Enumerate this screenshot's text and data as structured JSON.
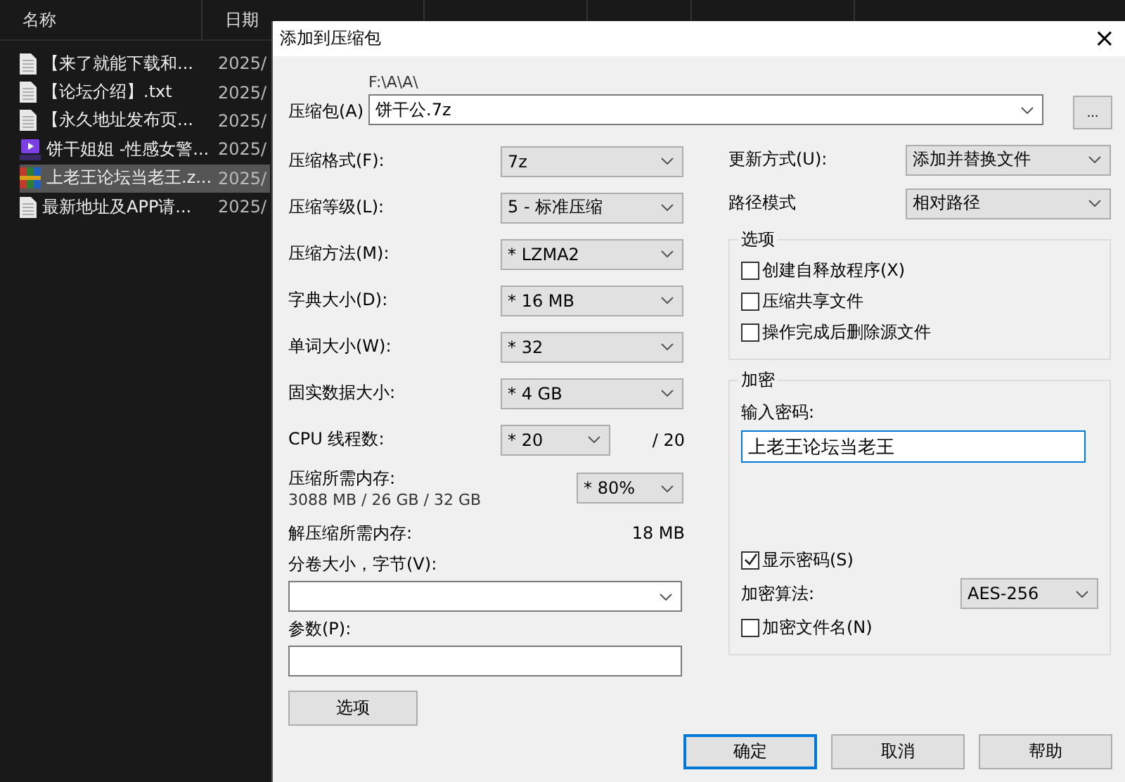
{
  "explorer": {
    "columns": [
      "名称",
      "日期"
    ],
    "files": [
      {
        "kind": "text",
        "name": "【来了就能下载和...",
        "date": "2025/",
        "selected": false
      },
      {
        "kind": "text",
        "name": "【论坛介绍】.txt",
        "date": "2025/",
        "selected": false
      },
      {
        "kind": "text",
        "name": "【永久地址发布页...",
        "date": "2025/",
        "selected": false
      },
      {
        "kind": "video",
        "name": "饼干姐姐 -性感女警...",
        "date": "2025/",
        "selected": false
      },
      {
        "kind": "archive",
        "name": "上老王论坛当老王.z...",
        "date": "2025/",
        "selected": true
      },
      {
        "kind": "text",
        "name": "最新地址及APP请...",
        "date": "2025/",
        "selected": false
      }
    ]
  },
  "dialog": {
    "title": "添加到压缩包",
    "close": "×",
    "archive": {
      "label": "压缩包(A)",
      "path": "F:\\A\\A\\",
      "value": "饼干公.7z",
      "browse": "..."
    },
    "left": [
      {
        "kind": "combo",
        "label": "压缩格式(F):",
        "value": "7z"
      },
      {
        "kind": "combo",
        "label": "压缩等级(L):",
        "value": "5 - 标准压缩"
      },
      {
        "kind": "combo",
        "label": "压缩方法(M):",
        "value": "* LZMA2"
      },
      {
        "kind": "combo",
        "label": "字典大小(D):",
        "value": "* 16 MB"
      },
      {
        "kind": "combo",
        "label": "单词大小(W):",
        "value": "* 32"
      },
      {
        "kind": "combo",
        "label": "固实数据大小:",
        "value": "* 4 GB"
      },
      {
        "kind": "threads",
        "label": "CPU 线程数:",
        "value": "* 20",
        "total": "/ 20"
      },
      {
        "kind": "memory",
        "label": "压缩所需内存:",
        "detail": "3088 MB / 26 GB / 32 GB",
        "value": "* 80%"
      },
      {
        "kind": "info",
        "label": "解压缩所需内存:",
        "value": "18 MB"
      }
    ],
    "volume": {
      "label": "分卷大小，字节(V):"
    },
    "params": {
      "label": "参数(P):"
    },
    "options_button": "选项",
    "right": [
      {
        "label": "更新方式(U):",
        "value": "添加并替换文件"
      },
      {
        "label": "路径模式",
        "value": "相对路径"
      }
    ],
    "options": {
      "title": "选项",
      "items": [
        {
          "label": "创建自释放程序(X)",
          "checked": false
        },
        {
          "label": "压缩共享文件",
          "checked": false
        },
        {
          "label": "操作完成后删除源文件",
          "checked": false
        }
      ]
    },
    "encryption": {
      "title": "加密",
      "password_label": "输入密码:",
      "password": "上老王论坛当老王",
      "show_password": {
        "label": "显示密码(S)",
        "checked": true
      },
      "method_label": "加密算法:",
      "method": "AES-256",
      "encrypt_names": {
        "label": "加密文件名(N)",
        "checked": false
      }
    },
    "buttons": [
      {
        "label": "确定",
        "selected": true
      },
      {
        "label": "取消",
        "selected": false
      },
      {
        "label": "帮助",
        "selected": false
      }
    ]
  }
}
